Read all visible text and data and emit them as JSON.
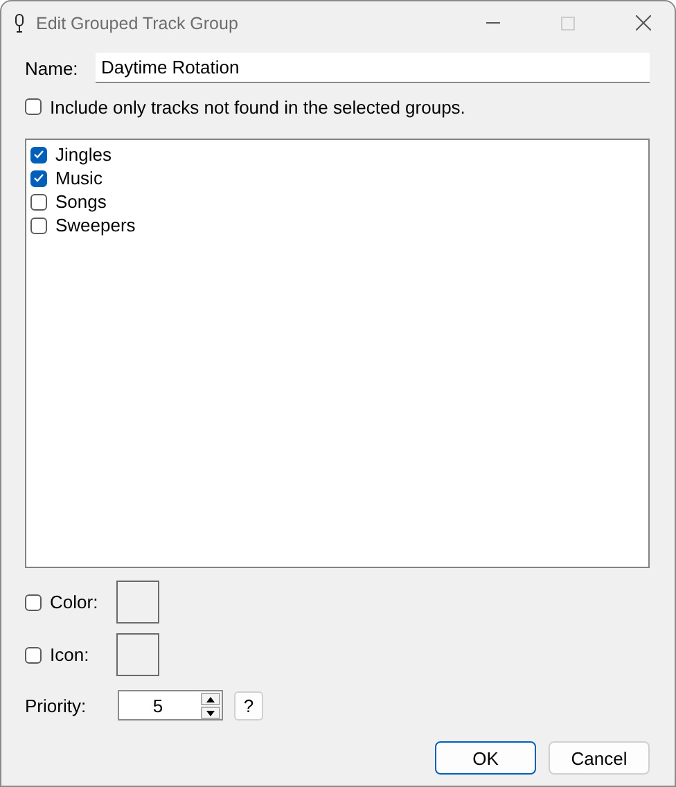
{
  "window": {
    "title": "Edit Grouped Track Group"
  },
  "name": {
    "label": "Name:",
    "value": "Daytime Rotation"
  },
  "exclude_option": {
    "label": "Include only tracks not found in the selected groups.",
    "checked": false
  },
  "groups": [
    {
      "label": "Jingles",
      "checked": true
    },
    {
      "label": "Music",
      "checked": true
    },
    {
      "label": "Songs",
      "checked": false
    },
    {
      "label": "Sweepers",
      "checked": false
    }
  ],
  "color": {
    "label": "Color:",
    "checked": false
  },
  "icon": {
    "label": "Icon:",
    "checked": false
  },
  "priority": {
    "label": "Priority:",
    "value": "5",
    "help": "?"
  },
  "buttons": [
    {
      "label": "OK",
      "default": true
    },
    {
      "label": "Cancel",
      "default": false
    }
  ]
}
